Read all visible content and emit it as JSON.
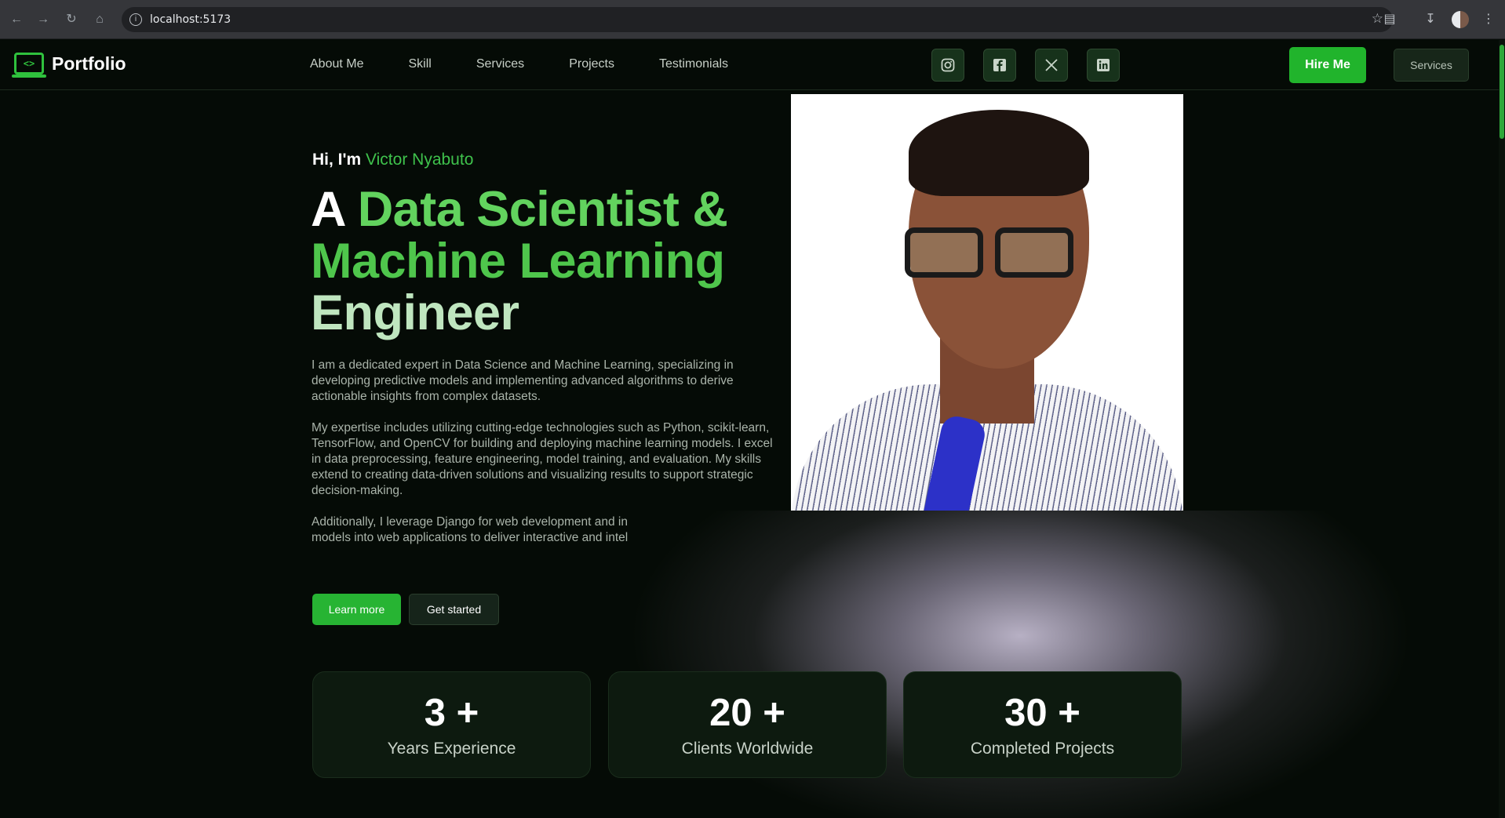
{
  "browser": {
    "url": "localhost:5173"
  },
  "nav": {
    "logo_text": "Portfolio",
    "logo_glyph": "<>",
    "links": [
      "About Me",
      "Skill",
      "Services",
      "Projects",
      "Testimonials"
    ],
    "socials": [
      "instagram-icon",
      "facebook-icon",
      "x-icon",
      "linkedin-icon"
    ],
    "hire_label": "Hire Me",
    "services_label": "Services"
  },
  "hero": {
    "greeting_prefix": "Hi, I'm",
    "greeting_name": "Victor Nyabuto",
    "headline_a": "A",
    "headline_ds": "Data Scientist &",
    "headline_ml": "Machine Learning",
    "headline_eng": "Engineer",
    "para1": "I am a dedicated expert in Data Science and Machine Learning, specializing in developing predictive models and implementing advanced algorithms to derive actionable insights from complex datasets.",
    "para2": "My expertise includes utilizing cutting-edge technologies such as Python, scikit-learn, TensorFlow, and OpenCV for building and deploying machine learning models. I excel in data preprocessing, feature engineering, model training, and evaluation. My skills extend to creating data-driven solutions and visualizing results to support strategic decision-making.",
    "para3": "Additionally, I leverage Django for web development and integrate machine learning models into web applications to deliver interactive and intelligent user experiences.",
    "learn_label": "Learn more",
    "start_label": "Get started"
  },
  "stats": [
    {
      "value": "3 +",
      "label": "Years Experience"
    },
    {
      "value": "20 +",
      "label": "Clients Worldwide"
    },
    {
      "value": "30 +",
      "label": "Completed Projects"
    }
  ],
  "colors": {
    "accent": "#21b42c",
    "background": "#050b06"
  }
}
